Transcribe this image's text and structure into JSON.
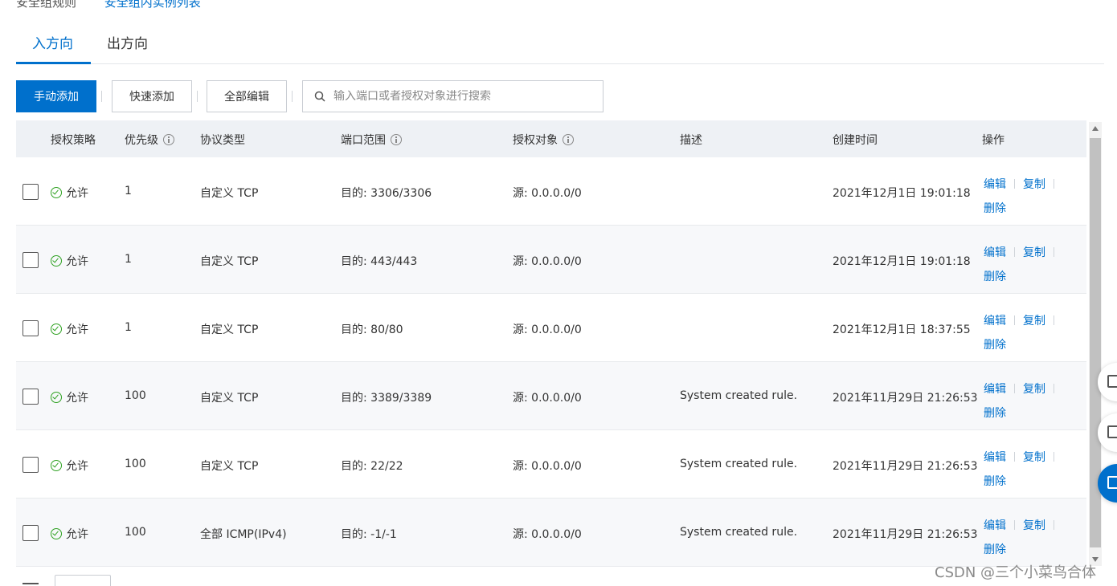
{
  "breadcrumb": {
    "left": "安全组规则",
    "right": "安全组内实例列表"
  },
  "tabs": [
    {
      "label": "入方向",
      "active": true
    },
    {
      "label": "出方向",
      "active": false
    }
  ],
  "toolbar": {
    "manual_add": "手动添加",
    "quick_add": "快速添加",
    "edit_all": "全部编辑",
    "search_placeholder": "输入端口或者授权对象进行搜索"
  },
  "columns": {
    "policy": "授权策略",
    "priority": "优先级",
    "protocol": "协议类型",
    "port_range": "端口范围",
    "source": "授权对象",
    "description": "描述",
    "created": "创建时间",
    "actions": "操作"
  },
  "actions": {
    "edit": "编辑",
    "copy": "复制",
    "delete": "删除"
  },
  "rows": [
    {
      "policy": "允许",
      "priority": "1",
      "protocol": "自定义 TCP",
      "port_range": "目的: 3306/3306",
      "source": "源: 0.0.0.0/0",
      "description": "",
      "created": "2021年12月1日 19:01:18"
    },
    {
      "policy": "允许",
      "priority": "1",
      "protocol": "自定义 TCP",
      "port_range": "目的: 443/443",
      "source": "源: 0.0.0.0/0",
      "description": "",
      "created": "2021年12月1日 19:01:18"
    },
    {
      "policy": "允许",
      "priority": "1",
      "protocol": "自定义 TCP",
      "port_range": "目的: 80/80",
      "source": "源: 0.0.0.0/0",
      "description": "",
      "created": "2021年12月1日 18:37:55"
    },
    {
      "policy": "允许",
      "priority": "100",
      "protocol": "自定义 TCP",
      "port_range": "目的: 3389/3389",
      "source": "源: 0.0.0.0/0",
      "description": "System created rule.",
      "created": "2021年11月29日 21:26:53"
    },
    {
      "policy": "允许",
      "priority": "100",
      "protocol": "自定义 TCP",
      "port_range": "目的: 22/22",
      "source": "源: 0.0.0.0/0",
      "description": "System created rule.",
      "created": "2021年11月29日 21:26:53"
    },
    {
      "policy": "允许",
      "priority": "100",
      "protocol": "全部 ICMP(IPv4)",
      "port_range": "目的: -1/-1",
      "source": "源: 0.0.0.0/0",
      "description": "System created rule.",
      "created": "2021年11月29日 21:26:53"
    }
  ],
  "watermark": "CSDN @三个小菜鸟合体",
  "colors": {
    "accent": "#0070cc",
    "success": "#2ea121",
    "header_bg": "#eef1f5"
  }
}
